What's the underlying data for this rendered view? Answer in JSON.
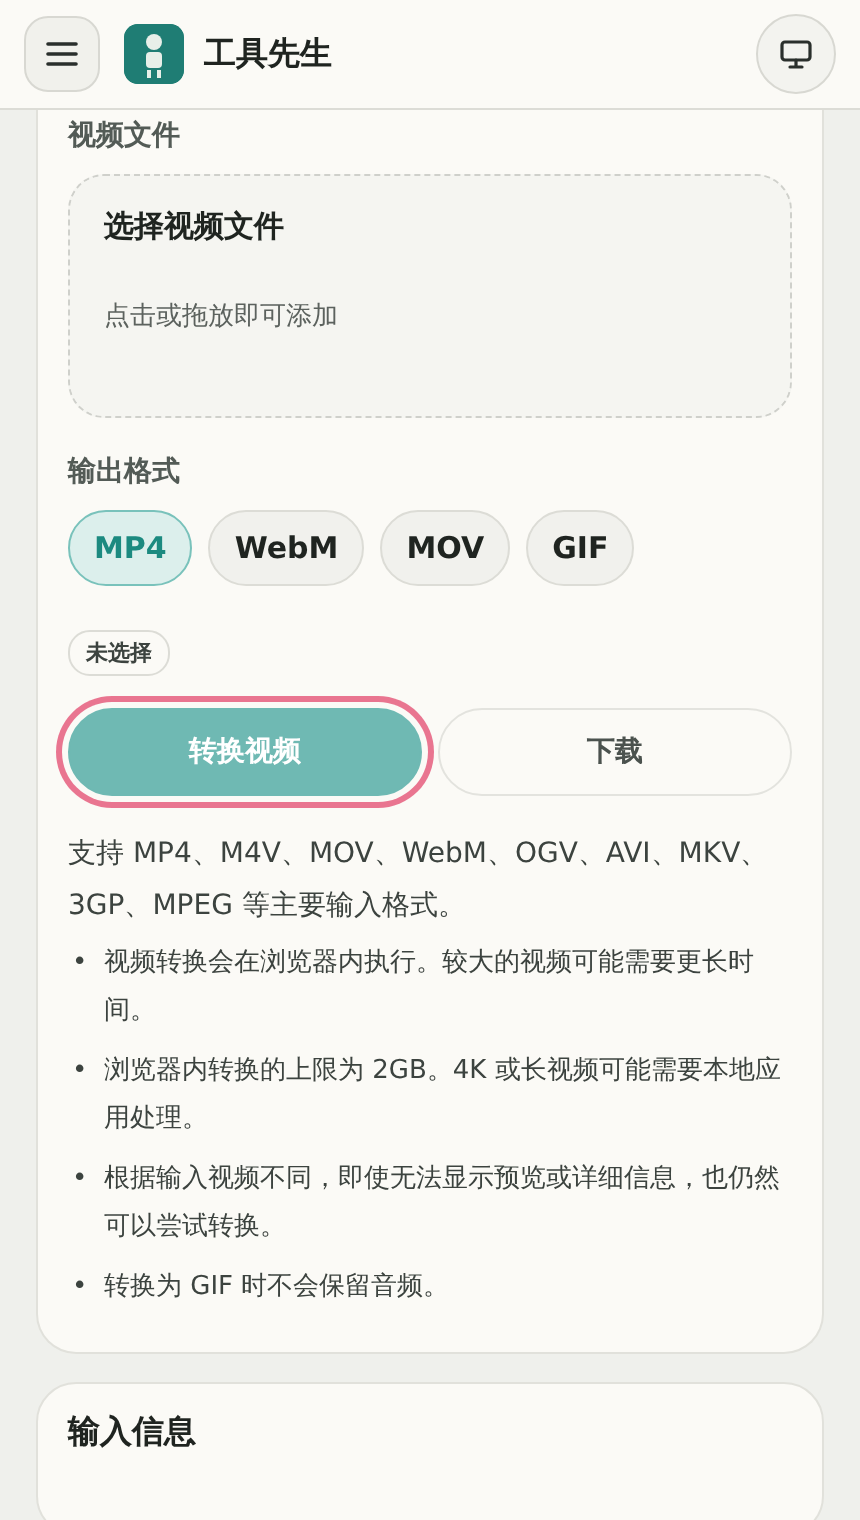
{
  "header": {
    "title": "工具先生"
  },
  "upload": {
    "label": "视频文件",
    "title": "选择视频文件",
    "hint": "点击或拖放即可添加"
  },
  "format": {
    "label": "输出格式",
    "options": [
      {
        "label": "MP4",
        "selected": true
      },
      {
        "label": "WebM",
        "selected": false
      },
      {
        "label": "MOV",
        "selected": false
      },
      {
        "label": "GIF",
        "selected": false
      }
    ]
  },
  "status_badge": "未选择",
  "actions": [
    {
      "label": "转换视频",
      "kind": "primary",
      "focused": true
    },
    {
      "label": "下载",
      "kind": "secondary",
      "focused": false
    }
  ],
  "description": "支持 MP4、M4V、MOV、WebM、OGV、AVI、MKV、3GP、MPEG 等主要输入格式。",
  "notes": [
    {
      "marker": "•",
      "text": "视频转换会在浏览器内执行。较大的视频可能需要更长时间。"
    },
    {
      "marker": "•",
      "text": "浏览器内转换的上限为 2GB。4K 或长视频可能需要本地应用处理。"
    },
    {
      "marker": "•",
      "text": "根据输入视频不同，即使无法显示预览或详细信息，也仍然可以尝试转换。"
    },
    {
      "marker": "•",
      "text": "转换为 GIF 时不会保留音频。"
    }
  ],
  "next_card": {
    "title": "输入信息"
  }
}
